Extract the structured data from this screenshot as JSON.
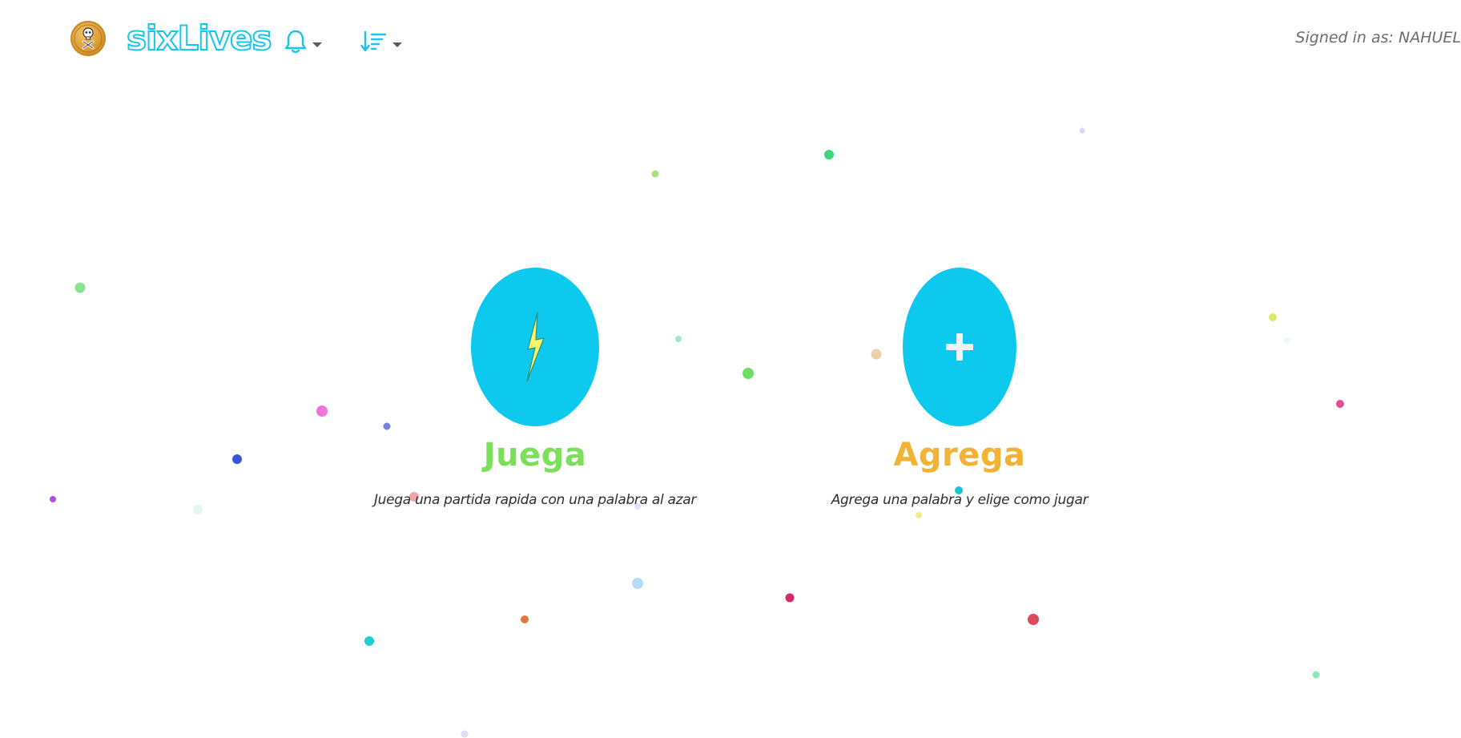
{
  "navbar": {
    "brand_name": "sixLives",
    "logo_icon": "skull-coin-icon",
    "notifications_icon": "bell-icon",
    "sort_icon": "sort-descending-icon",
    "signed_in_text": "Signed in as: NAHUEL"
  },
  "actions": [
    {
      "title": "Juega",
      "description": "Juega una partida rapida con una palabra al azar",
      "icon": "lightning-bolt-icon",
      "title_color": "#7cdf5a"
    },
    {
      "title": "Agrega",
      "description": "Agrega una palabra y elige como jugar",
      "icon": "plus-icon",
      "title_color": "#f2b234"
    }
  ],
  "colors": {
    "accent": "#0ec9ee",
    "brand_outline": "#18c6ea",
    "text_muted": "#6b6b6b",
    "text_body": "#2d2d2d"
  }
}
